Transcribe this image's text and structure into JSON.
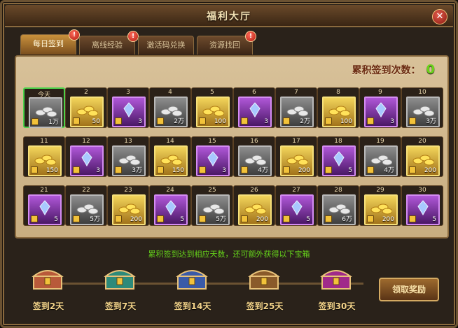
{
  "window": {
    "title": "福利大厅"
  },
  "tabs": [
    {
      "label": "每日签到",
      "active": true,
      "badge": "!"
    },
    {
      "label": "离线经验",
      "active": false,
      "badge": "!"
    },
    {
      "label": "激活码兑换",
      "active": false,
      "badge": ""
    },
    {
      "label": "资源找回",
      "active": false,
      "badge": "!"
    }
  ],
  "signin": {
    "label": "累积签到次数：",
    "value": "0"
  },
  "days": [
    {
      "day": "今天",
      "type": "silver",
      "qty": "1万"
    },
    {
      "day": "2",
      "type": "gold",
      "qty": "50"
    },
    {
      "day": "3",
      "type": "crystal",
      "qty": "3"
    },
    {
      "day": "4",
      "type": "silver",
      "qty": "2万"
    },
    {
      "day": "5",
      "type": "gold",
      "qty": "100"
    },
    {
      "day": "6",
      "type": "crystal",
      "qty": "3"
    },
    {
      "day": "7",
      "type": "silver",
      "qty": "2万"
    },
    {
      "day": "8",
      "type": "gold",
      "qty": "100"
    },
    {
      "day": "9",
      "type": "crystal",
      "qty": "3"
    },
    {
      "day": "10",
      "type": "silver",
      "qty": "3万"
    },
    {
      "day": "11",
      "type": "gold",
      "qty": "150"
    },
    {
      "day": "12",
      "type": "crystal",
      "qty": "3"
    },
    {
      "day": "13",
      "type": "silver",
      "qty": "3万"
    },
    {
      "day": "14",
      "type": "gold",
      "qty": "150"
    },
    {
      "day": "15",
      "type": "crystal",
      "qty": "3"
    },
    {
      "day": "16",
      "type": "silver",
      "qty": "4万"
    },
    {
      "day": "17",
      "type": "gold",
      "qty": "200"
    },
    {
      "day": "18",
      "type": "crystal",
      "qty": "5"
    },
    {
      "day": "19",
      "type": "silver",
      "qty": "4万"
    },
    {
      "day": "20",
      "type": "gold",
      "qty": "200"
    },
    {
      "day": "21",
      "type": "crystal",
      "qty": "5"
    },
    {
      "day": "22",
      "type": "silver",
      "qty": "5万"
    },
    {
      "day": "23",
      "type": "gold",
      "qty": "200"
    },
    {
      "day": "24",
      "type": "crystal",
      "qty": "5"
    },
    {
      "day": "25",
      "type": "silver",
      "qty": "5万"
    },
    {
      "day": "26",
      "type": "gold",
      "qty": "200"
    },
    {
      "day": "27",
      "type": "crystal",
      "qty": "5"
    },
    {
      "day": "28",
      "type": "silver",
      "qty": "6万"
    },
    {
      "day": "29",
      "type": "gold",
      "qty": "200"
    },
    {
      "day": "30",
      "type": "crystal",
      "qty": "5"
    }
  ],
  "rewards_note": "累积签到达到相应天数，还可额外获得以下宝箱",
  "rewards": [
    {
      "label": "签到2天",
      "chest": "chest-icon",
      "color": "#b85a3a"
    },
    {
      "label": "签到7天",
      "chest": "chest-icon",
      "color": "#2d8a7a"
    },
    {
      "label": "签到14天",
      "chest": "chest-icon",
      "color": "#3a5aa8"
    },
    {
      "label": "签到25天",
      "chest": "chest-icon",
      "color": "#8a5a2a"
    },
    {
      "label": "签到30天",
      "chest": "chest-icon",
      "color": "#a02a8a"
    }
  ],
  "claim_button": "领取奖励"
}
